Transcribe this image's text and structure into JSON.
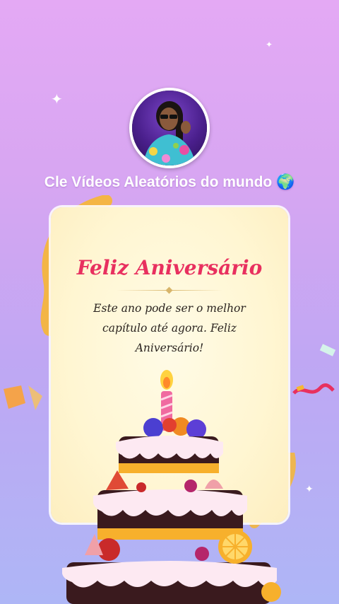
{
  "profile": {
    "creator_name": "Cle Vídeos Aleatórios do mundo 🌍",
    "avatar_icon": "profile-photo"
  },
  "card": {
    "title": "Feliz Aniversário",
    "message": "Este ano pode ser o melhor capítulo até agora. Feliz Aniversário!"
  },
  "colors": {
    "title": "#e8305f",
    "background_top": "#e4a9f4",
    "background_bottom": "#aeb6f6"
  }
}
